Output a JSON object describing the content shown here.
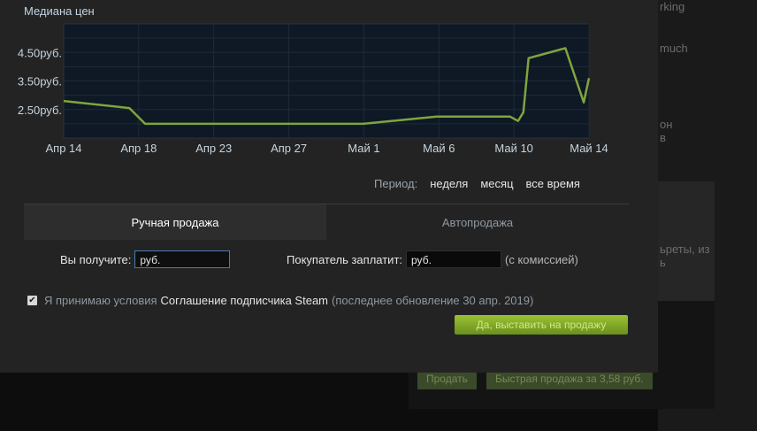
{
  "background": {
    "right_texts": [
      "rking",
      "much",
      "он",
      "в",
      "ьреты, из",
      "ь"
    ],
    "sell_button": "Продать",
    "quick_sell_button": "Быстрая продажа за 3,58 руб."
  },
  "chart": {
    "title": "Медиана цен",
    "y_tick_labels": [
      "4.50руб.",
      "3.50руб.",
      "2.50руб."
    ],
    "x_tick_labels": [
      "Апр 14",
      "Апр 18",
      "Апр 23",
      "Апр 27",
      "Май 1",
      "Май 6",
      "Май 10",
      "Май 14"
    ],
    "line_color": "#7fa53c",
    "plot_bg": "#0f1825"
  },
  "chart_data": {
    "type": "line",
    "title": "Медиана цен",
    "xlabel": "",
    "ylabel": "",
    "x": [
      "Апр 14",
      "Апр 18",
      "Апр 18 (late)",
      "Апр 23",
      "Апр 27",
      "Май 1",
      "Май 6",
      "Май 9",
      "Май 10",
      "Май 10 (mid)",
      "Май 11",
      "Май 11 (late)",
      "Май 13",
      "Май 14",
      "Май 14 (end)"
    ],
    "series": [
      {
        "values": [
          2.8,
          2.55,
          2.0,
          2.0,
          2.0,
          2.0,
          2.25,
          2.25,
          2.1,
          2.4,
          4.3,
          4.4,
          4.65,
          2.75,
          3.6
        ]
      }
    ],
    "ylim": [
      1.5,
      5.5
    ],
    "grid": true
  },
  "period": {
    "label": "Период:",
    "options": [
      "неделя",
      "месяц",
      "все время"
    ]
  },
  "tabs": {
    "manual": "Ручная продажа",
    "auto": "Автопродажа"
  },
  "receive": {
    "label": "Вы получите:",
    "value": "руб."
  },
  "buyer_pays": {
    "label": "Покупатель заплатит:",
    "value": "руб.",
    "hint": "(с комиссией)"
  },
  "agreement": {
    "checked": true,
    "check_glyph": "✔",
    "prefix": "Я принимаю условия",
    "link": "Соглашение подписчика Steam",
    "suffix": "(последнее обновление 30 апр. 2019)"
  },
  "submit_button": "Да, выставить на продажу"
}
